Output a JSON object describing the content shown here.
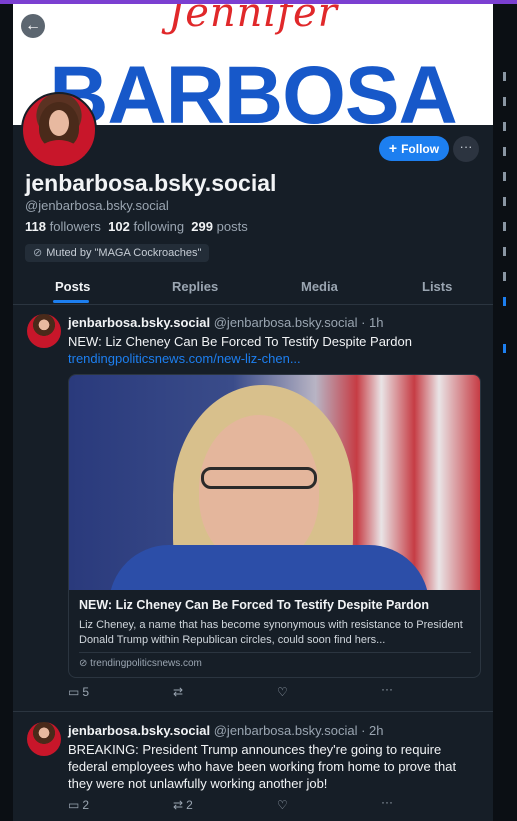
{
  "banner": {
    "script_text": "Jennifer",
    "big_text": "BARBOSA"
  },
  "profile": {
    "display_name": "jenbarbosa.bsky.social",
    "handle": "@jenbarbosa.bsky.social",
    "followers_count": "118",
    "followers_label": "followers",
    "following_count": "102",
    "following_label": "following",
    "posts_count": "299",
    "posts_label": "posts",
    "muted_label": "Muted by \"MAGA Cockroaches\"",
    "follow_label": "Follow",
    "more_label": "···"
  },
  "nav": {
    "back_label": "←"
  },
  "tabs": [
    {
      "label": "Posts"
    },
    {
      "label": "Replies"
    },
    {
      "label": "Media"
    },
    {
      "label": "Lists"
    }
  ],
  "posts": [
    {
      "author": "jenbarbosa.bsky.social",
      "handle": "@jenbarbosa.bsky.social",
      "time": "· 1h",
      "text": "NEW: Liz Cheney Can Be Forced To Testify Despite Pardon",
      "link": "trendingpoliticsnews.com/new-liz-chen...",
      "embed": {
        "title": "NEW: Liz Cheney Can Be Forced To Testify Despite Pardon",
        "description": "Liz Cheney, a name that has become synonymous with resistance to President Donald Trump within Republican circles, could soon find hers...",
        "domain": "trendingpoliticsnews.com"
      },
      "replies": "5",
      "reposts": "",
      "likes": ""
    },
    {
      "author": "jenbarbosa.bsky.social",
      "handle": "@jenbarbosa.bsky.social",
      "time": "· 2h",
      "text": "BREAKING: President Trump announces they're going to require federal employees who have been working from home to prove that they were not unlawfully working another job!",
      "replies": "2",
      "reposts": "2",
      "likes": ""
    }
  ],
  "icons": {
    "back": "arrow-left-icon",
    "plus": "plus-icon",
    "muted": "eye-slash-icon",
    "reply": "speech-bubble-icon",
    "repost": "repost-icon",
    "like": "heart-icon",
    "more": "ellipsis-icon",
    "globe": "globe-icon"
  },
  "colors": {
    "accent": "#1d7ff0",
    "background": "#161e27",
    "top_bar": "#7b3fd1"
  }
}
